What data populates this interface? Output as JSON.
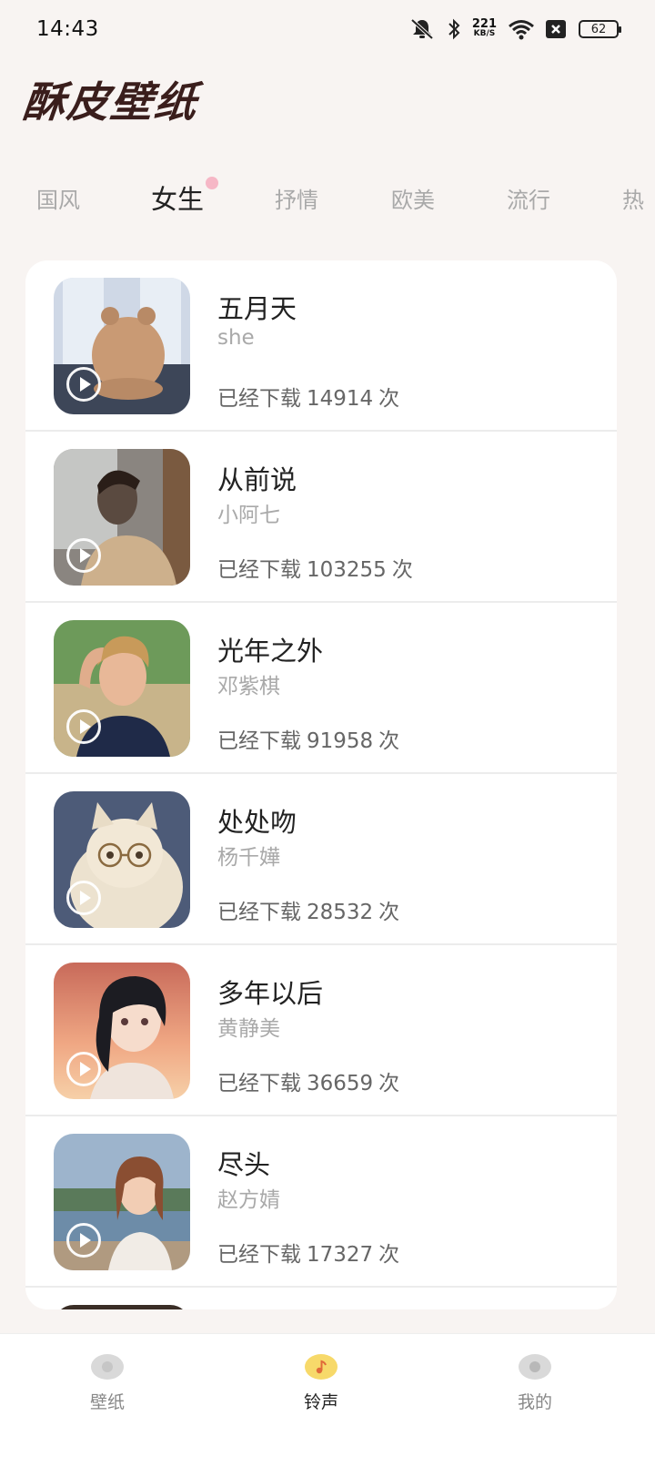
{
  "status_bar": {
    "time": "14:43",
    "net_speed_value": "221",
    "net_speed_unit": "KB/S",
    "battery": "62",
    "icons": [
      "mute-bell-icon",
      "bluetooth-icon",
      "wifi-icon",
      "close-box-icon"
    ]
  },
  "app": {
    "title": "酥皮壁纸"
  },
  "tabs": [
    {
      "label": "国风",
      "active": false
    },
    {
      "label": "女生",
      "active": true
    },
    {
      "label": "抒情",
      "active": false
    },
    {
      "label": "欧美",
      "active": false
    },
    {
      "label": "流行",
      "active": false
    },
    {
      "label": "热",
      "active": false
    }
  ],
  "songs": [
    {
      "title": "五月天",
      "artist": "she",
      "downloads_prefix": "已经下载",
      "count": "14914",
      "downloads_suffix": "次"
    },
    {
      "title": "从前说",
      "artist": "小阿七",
      "downloads_prefix": "已经下载",
      "count": "103255",
      "downloads_suffix": "次"
    },
    {
      "title": "光年之外",
      "artist": "邓紫棋",
      "downloads_prefix": "已经下载",
      "count": "91958",
      "downloads_suffix": "次"
    },
    {
      "title": "处处吻",
      "artist": "杨千嬅",
      "downloads_prefix": "已经下载",
      "count": "28532",
      "downloads_suffix": "次"
    },
    {
      "title": "多年以后",
      "artist": "黄静美",
      "downloads_prefix": "已经下载",
      "count": "36659",
      "downloads_suffix": "次"
    },
    {
      "title": "尽头",
      "artist": "赵方婧",
      "downloads_prefix": "已经下载",
      "count": "17327",
      "downloads_suffix": "次"
    }
  ],
  "bottom_nav": [
    {
      "label": "壁纸",
      "icon": "wallpaper-icon",
      "active": false
    },
    {
      "label": "铃声",
      "icon": "music-note-icon",
      "active": true
    },
    {
      "label": "我的",
      "icon": "profile-icon",
      "active": false
    }
  ],
  "colors": {
    "background": "#f8f4f2",
    "title": "#3a1e1c",
    "active_nav": "#f7d96a",
    "tab_dot": "#f6b7c6"
  }
}
